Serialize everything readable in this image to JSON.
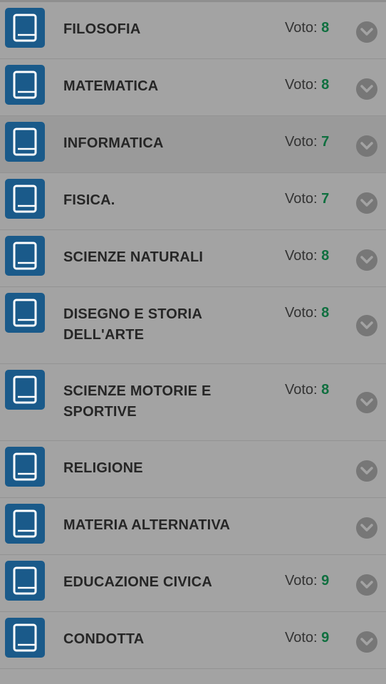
{
  "grade_label": "Voto:",
  "subjects": [
    {
      "name": "FILOSOFIA",
      "grade": "8"
    },
    {
      "name": "MATEMATICA",
      "grade": "8"
    },
    {
      "name": "INFORMATICA",
      "grade": "7"
    },
    {
      "name": "FISICA.",
      "grade": "7"
    },
    {
      "name": "SCIENZE NATURALI",
      "grade": "8"
    },
    {
      "name": "DISEGNO E STORIA DELL'ARTE",
      "grade": "8"
    },
    {
      "name": "SCIENZE MOTORIE E SPORTIVE",
      "grade": "8"
    },
    {
      "name": "RELIGIONE",
      "grade": ""
    },
    {
      "name": "MATERIA ALTERNATIVA",
      "grade": ""
    },
    {
      "name": "EDUCAZIONE CIVICA",
      "grade": "9"
    },
    {
      "name": "CONDOTTA",
      "grade": "9"
    }
  ],
  "colors": {
    "icon_background": "#1a5a8a",
    "grade_value": "#0f6f3f",
    "chevron_background": "#777777",
    "page_background": "#a3a3a3"
  }
}
